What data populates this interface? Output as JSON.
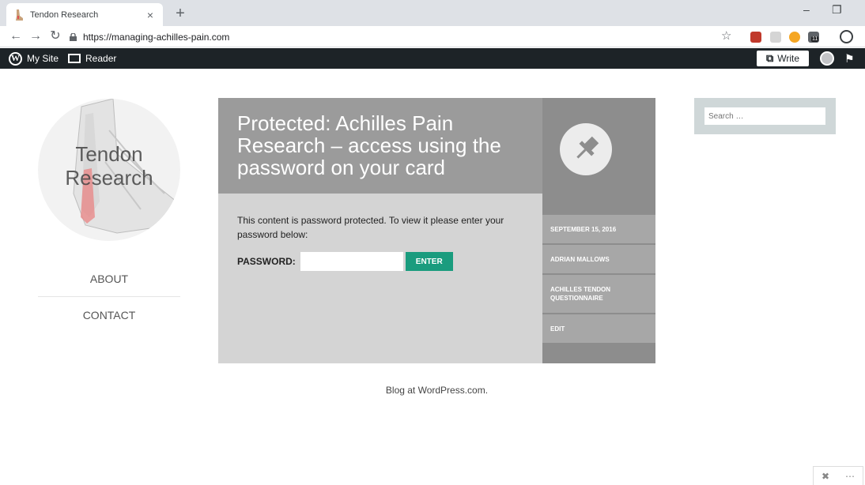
{
  "browser": {
    "tab_title": "Tendon Research",
    "tab_close": "×",
    "new_tab": "+",
    "url": "https://managing-achilles-pain.com",
    "extension_badge": "11"
  },
  "masterbar": {
    "my_site": "My Site",
    "reader": "Reader",
    "write": "Write"
  },
  "site": {
    "title_line1": "Tendon",
    "title_line2": "Research",
    "nav": [
      {
        "label": "ABOUT"
      },
      {
        "label": "CONTACT"
      }
    ]
  },
  "post": {
    "title": "Protected: Achilles Pain Research – access using the password on your card",
    "protected_message": "This content is password protected. To view it please enter your password below:",
    "password_label": "PASSWORD:",
    "enter_label": "ENTER",
    "meta": [
      {
        "label": "SEPTEMBER 15, 2016"
      },
      {
        "label": "ADRIAN MALLOWS"
      },
      {
        "label": "ACHILLES TENDON QUESTIONNAIRE"
      },
      {
        "label": "EDIT"
      }
    ]
  },
  "sidebar": {
    "search_placeholder": "Search …"
  },
  "footer": {
    "text": "Blog at WordPress.com."
  },
  "colors": {
    "masterbar": "#1d2327",
    "enter_button": "#1a9c7e",
    "post_header": "#9b9b9b",
    "post_meta": "#8d8d8d"
  }
}
